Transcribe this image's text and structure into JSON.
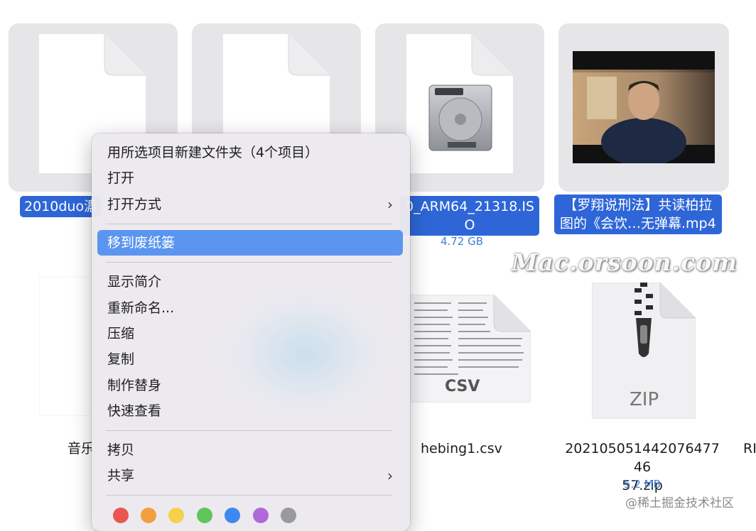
{
  "files": {
    "f1": {
      "name_partial": "2010duo濃"
    },
    "f3": {
      "name_line1": "0_ARM64_21318.IS",
      "name_line2": "O",
      "size": "4.72 GB"
    },
    "f4": {
      "name_line1": "【罗翔说刑法】共读柏拉",
      "name_line2": "图的《会饮…无弹幕.mp4"
    },
    "f5": {
      "name_partial": "音乐"
    },
    "f7": {
      "name": "hebing1.csv",
      "icon_text": "CSV"
    },
    "f8": {
      "name_line1": "202105051442076477 46",
      "name_line2": "57.zip",
      "size": "5.2 MB",
      "icon_text": "ZIP"
    },
    "f9": {
      "name_partial": "RI"
    }
  },
  "menu": {
    "items": [
      {
        "label": "用所选项目新建文件夹（4个项目）"
      },
      {
        "label": "打开"
      },
      {
        "label": "打开方式"
      },
      {
        "label": "移到废纸篓"
      },
      {
        "label": "显示简介"
      },
      {
        "label": "重新命名..."
      },
      {
        "label": "压缩"
      },
      {
        "label": "复制"
      },
      {
        "label": "制作替身"
      },
      {
        "label": "快速查看"
      },
      {
        "label": "拷贝"
      },
      {
        "label": "共享"
      }
    ],
    "tag_colors": [
      "#e8584e",
      "#f2a03d",
      "#f5d04a",
      "#5fc65a",
      "#3e89f0",
      "#b06ad8",
      "#9a9a9c"
    ]
  },
  "watermark": "Mac.orsoon.com",
  "credit": "@稀土掘金技术社区",
  "colors": {
    "selection": "#2e66d8",
    "menu_highlight": "#5b95f0",
    "size_text": "#3d7fd9"
  }
}
